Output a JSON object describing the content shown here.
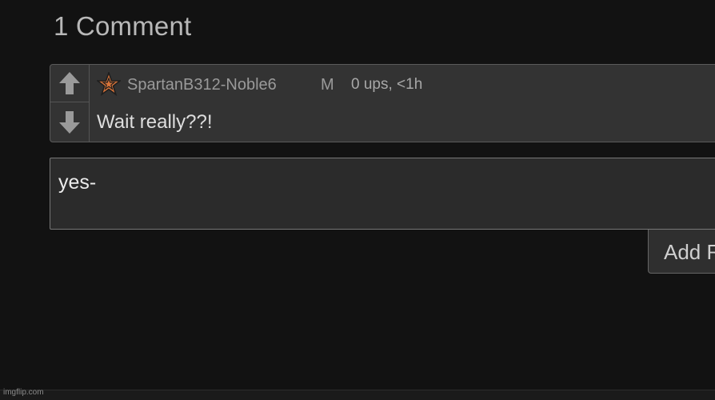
{
  "comments_heading": "1 Comment",
  "comment": {
    "username": "SpartanB312-Noble6",
    "gender": "M",
    "meta": "0 ups, <1h",
    "text": "Wait really??!",
    "badge_icon": "star-badge-icon",
    "upvote_icon": "arrow-up-icon",
    "downvote_icon": "arrow-down-icon"
  },
  "reply": {
    "value": "yes-"
  },
  "add_button": {
    "label": "Add Reply"
  },
  "watermark": "imgflip.com",
  "colors": {
    "background": "#121212",
    "comment_bg": "#333333",
    "badge_fill": "#d9743a",
    "arrow": "#9a9a9a"
  }
}
